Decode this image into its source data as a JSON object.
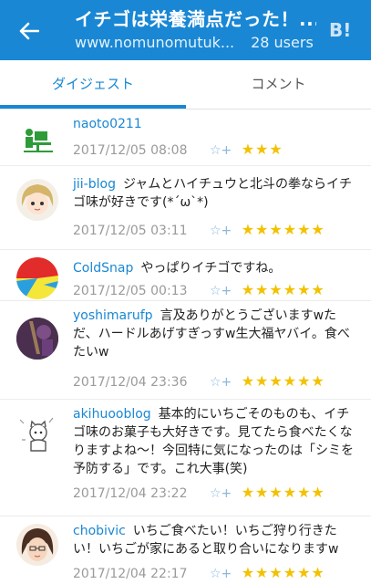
{
  "header": {
    "title": "イチゴは栄養満点だった！...",
    "url": "www.nomunomutuk...",
    "users": "28 users",
    "logo": "B!"
  },
  "tabs": [
    {
      "label": "ダイジェスト",
      "active": true
    },
    {
      "label": "コメント",
      "active": false
    }
  ],
  "comments": [
    {
      "user": "naoto0211",
      "text": "",
      "date": "2017/12/05 08:08",
      "stars": "★★★",
      "star_count": 3
    },
    {
      "user": "jii-blog",
      "text": "ジャムとハイチュウと北斗の拳ならイチゴ味が好きです(*´ω`*)",
      "date": "2017/12/05 03:11",
      "stars": "★★★★★★",
      "star_count": 6
    },
    {
      "user": "ColdSnap",
      "text": "やっぱりイチゴですね。",
      "date": "2017/12/05 00:13",
      "stars": "★★★★★★",
      "star_count": 6
    },
    {
      "user": "yoshimarufp",
      "text": "言及ありがとうございますwただ、ハードルあげすぎっすw生大福ヤバイ。食べたいw",
      "date": "2017/12/04 23:36",
      "stars": "★★★★★★",
      "star_count": 6
    },
    {
      "user": "akihuooblog",
      "text": "基本的にいちごそのものも、イチゴ味のお菓子も大好きです。見てたら食べたくなりますよね～！今回特に気になったのは「シミを予防する」です。これ大事(笑)",
      "date": "2017/12/04 23:22",
      "stars": "★★★★★★",
      "star_count": 6
    },
    {
      "user": "chobivic",
      "text": "いちご食べたい！いちご狩り行きたい！いちごが家にあると取り合いになりますw",
      "date": "2017/12/04 22:17",
      "stars": "★★★★★★",
      "star_count": 6
    }
  ],
  "colors": {
    "accent": "#1987d4",
    "star": "#f2c200"
  },
  "icons": {
    "back": "arrow-left-icon",
    "add_star": "add-star-icon"
  }
}
